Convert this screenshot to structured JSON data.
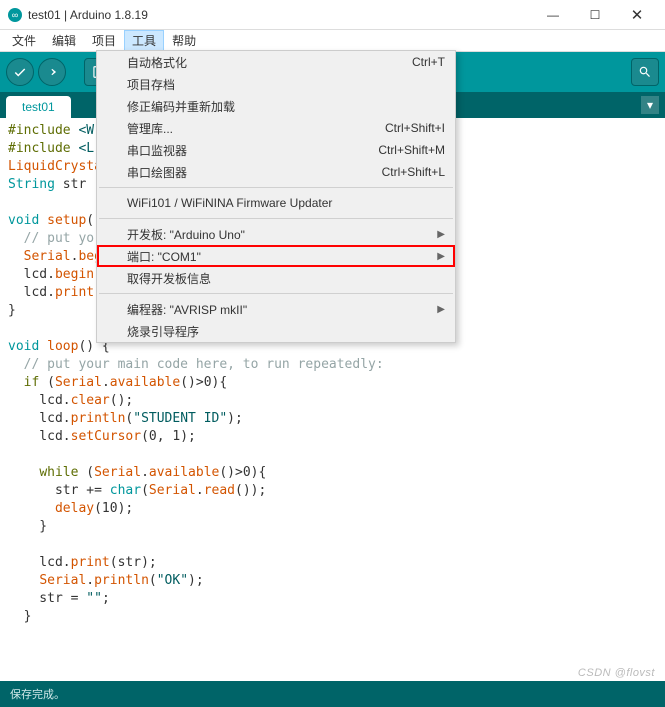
{
  "window": {
    "title": "test01 | Arduino 1.8.19",
    "minimize": "—",
    "maximize": "☐",
    "close": "✕"
  },
  "menubar": {
    "items": [
      "文件",
      "编辑",
      "项目",
      "工具",
      "帮助"
    ],
    "activeIndex": 3
  },
  "toolbar": {
    "verify": "✓",
    "upload": "→",
    "new": "▤",
    "open": "↑",
    "save": "↓",
    "serial": "🔍"
  },
  "tab": {
    "name": "test01",
    "dropdown": "▾"
  },
  "dropdown": {
    "items": [
      {
        "label": "自动格式化",
        "shortcut": "Ctrl+T",
        "type": "item"
      },
      {
        "label": "项目存档",
        "shortcut": "",
        "type": "item"
      },
      {
        "label": "修正编码并重新加载",
        "shortcut": "",
        "type": "item"
      },
      {
        "label": "管理库...",
        "shortcut": "Ctrl+Shift+I",
        "type": "item"
      },
      {
        "label": "串口监视器",
        "shortcut": "Ctrl+Shift+M",
        "type": "item"
      },
      {
        "label": "串口绘图器",
        "shortcut": "Ctrl+Shift+L",
        "type": "item"
      },
      {
        "type": "sep"
      },
      {
        "label": "WiFi101 / WiFiNINA Firmware Updater",
        "shortcut": "",
        "type": "item"
      },
      {
        "type": "sep"
      },
      {
        "label": "开发板: \"Arduino Uno\"",
        "shortcut": "",
        "type": "submenu"
      },
      {
        "label": "端口: \"COM1\"",
        "shortcut": "",
        "type": "submenu",
        "highlighted": true
      },
      {
        "label": "取得开发板信息",
        "shortcut": "",
        "type": "item"
      },
      {
        "type": "sep"
      },
      {
        "label": "编程器: \"AVRISP mkII\"",
        "shortcut": "",
        "type": "submenu"
      },
      {
        "label": "烧录引导程序",
        "shortcut": "",
        "type": "item"
      }
    ]
  },
  "code": {
    "l1a": "#include",
    "l1b": " <W",
    "l2a": "#include",
    "l2b": " <L",
    "l3a": "LiquidCrysta",
    "l4a": "String",
    "l4b": " str ",
    "l6a": "void",
    "l6b": " ",
    "l6c": "setup",
    "l6d": "()",
    "l7a": "  // put yo",
    "l8a": "  ",
    "l8b": "Serial",
    "l8c": ".",
    "l8d": "beg",
    "l9a": "  lcd.",
    "l9b": "begin",
    "l10a": "  lcd.",
    "l10b": "print",
    "l11a": "}",
    "l13a": "void",
    "l13b": " ",
    "l13c": "loop",
    "l13d": "() {",
    "l14a": "  // put your main code here, to run repeatedly:",
    "l15a": "  ",
    "l15b": "if",
    "l15c": " (",
    "l15d": "Serial",
    "l15e": ".",
    "l15f": "available",
    "l15g": "()>0){",
    "l16a": "    lcd.",
    "l16b": "clear",
    "l16c": "();",
    "l17a": "    lcd.",
    "l17b": "println",
    "l17c": "(",
    "l17d": "\"STUDENT ID\"",
    "l17e": ");",
    "l18a": "    lcd.",
    "l18b": "setCursor",
    "l18c": "(0, 1);",
    "l20a": "    ",
    "l20b": "while",
    "l20c": " (",
    "l20d": "Serial",
    "l20e": ".",
    "l20f": "available",
    "l20g": "()>0){",
    "l21a": "      str += ",
    "l21b": "char",
    "l21c": "(",
    "l21d": "Serial",
    "l21e": ".",
    "l21f": "read",
    "l21g": "());",
    "l22a": "      ",
    "l22b": "delay",
    "l22c": "(10);",
    "l23a": "    }",
    "l25a": "    lcd.",
    "l25b": "print",
    "l25c": "(str);",
    "l26a": "    ",
    "l26b": "Serial",
    "l26c": ".",
    "l26d": "println",
    "l26e": "(",
    "l26f": "\"OK\"",
    "l26g": ");",
    "l27a": "    str = ",
    "l27b": "\"\"",
    "l27c": ";",
    "l28a": "  }"
  },
  "statusbar": {
    "left": "保存完成。",
    "right": ""
  },
  "watermark": "CSDN @flovst"
}
